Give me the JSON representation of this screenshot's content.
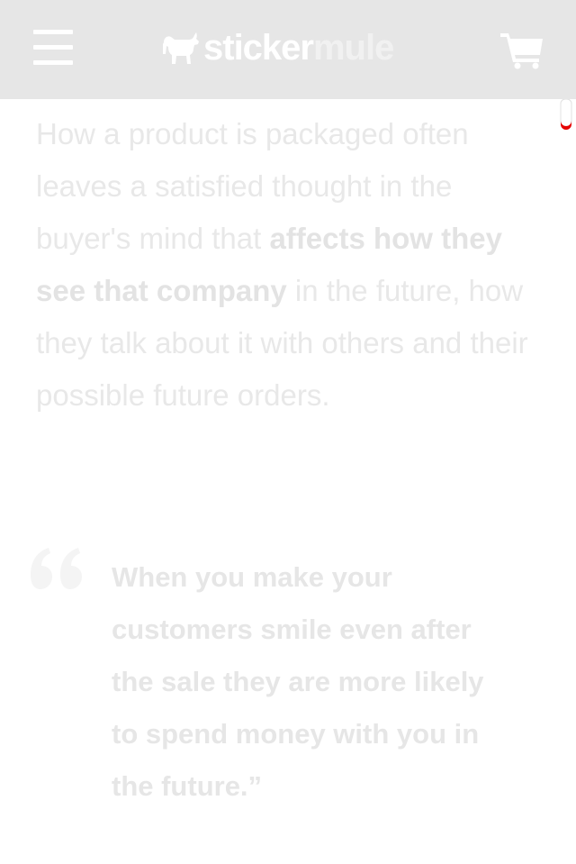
{
  "header": {
    "brand_part1": "sticker",
    "brand_part2": "mule",
    "background": "#e6e6e6",
    "icons": [
      "menu-icon",
      "goat-logo-icon",
      "cart-icon"
    ]
  },
  "article": {
    "text_before": "How a product is packaged often leaves a satisfied thought in the buyer's mind that ",
    "emphasis": "affects how they see that company",
    "text_after": " in the future, how they talk about it with others and their possible future orders."
  },
  "quote": {
    "text": "When you make your customers smile even after the sale they are more likely to spend money with you in the future.”"
  },
  "colors": {
    "text": "#e8e8e8",
    "accent": "#e60000"
  }
}
